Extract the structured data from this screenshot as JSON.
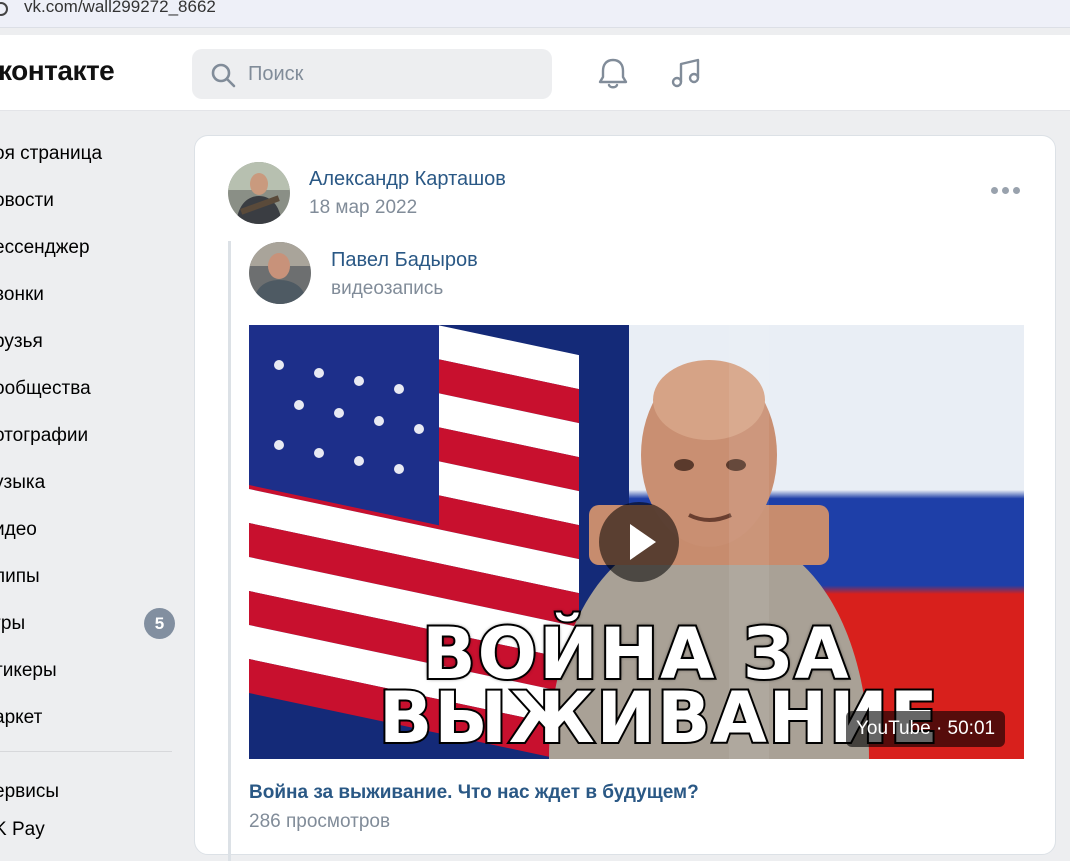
{
  "browser": {
    "url": "vk.com/wall299272_8662"
  },
  "header": {
    "logo_text": "контакте",
    "search_placeholder": "Поиск",
    "icons": [
      "bell-icon",
      "music-note-icon"
    ]
  },
  "sidebar": {
    "items": [
      {
        "label": "оя страница"
      },
      {
        "label": "овости"
      },
      {
        "label": "ессенджер"
      },
      {
        "label": "вонки"
      },
      {
        "label": "рузья"
      },
      {
        "label": "ообщества"
      },
      {
        "label": "отографии"
      },
      {
        "label": "узыка"
      },
      {
        "label": "идео"
      },
      {
        "label": "липы"
      },
      {
        "label": "гры",
        "badge": "5"
      },
      {
        "label": "тикеры"
      },
      {
        "label": "аркет"
      }
    ],
    "bottom_items": [
      {
        "label": "ервисы"
      },
      {
        "label": "K Pay"
      }
    ]
  },
  "post": {
    "author": "Александр Карташов",
    "date": "18 мар 2022",
    "repost": {
      "author": "Павел Бадыров",
      "subtitle": "видеозапись"
    },
    "video": {
      "thumb_line1": "ВОЙНА ЗА",
      "thumb_line2": "ВЫЖИВАНИЕ",
      "duration_label": "YouTube · 50:01",
      "title": "Война за выживание. Что нас ждет в будущем?",
      "views": "286 просмотров"
    }
  },
  "colors": {
    "link": "#2a5885",
    "muted": "#818c99",
    "bg": "#edeef0",
    "badge": "#828fa0"
  }
}
